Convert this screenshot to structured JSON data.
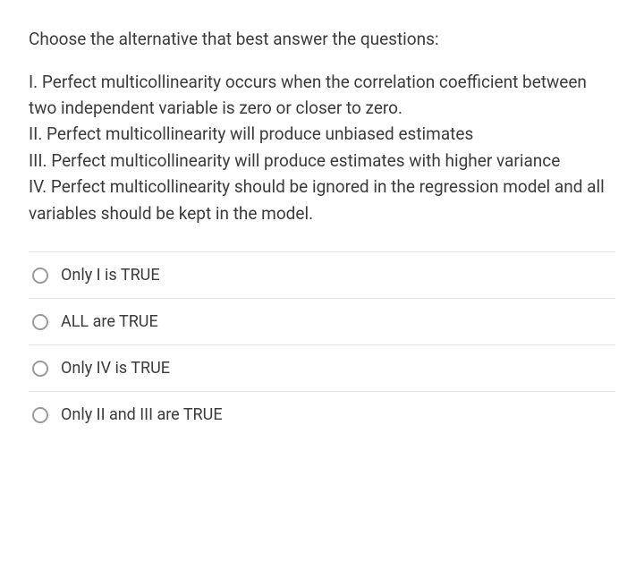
{
  "question": {
    "intro": "Choose the alternative that best answer the questions:",
    "statements": [
      "I. Perfect multicollinearity occurs when the correlation coefficient between two independent variable is zero or closer to zero.",
      "II. Perfect multicollinearity will produce unbiased estimates",
      "III. Perfect multicollinearity will produce estimates with higher variance",
      "IV. Perfect multicollinearity should be ignored in the regression model and all variables should be kept in the model."
    ],
    "options": [
      {
        "label": "Only I is TRUE"
      },
      {
        "label": "ALL are TRUE"
      },
      {
        "label": "Only IV is TRUE"
      },
      {
        "label": "Only II and III are TRUE"
      }
    ]
  }
}
